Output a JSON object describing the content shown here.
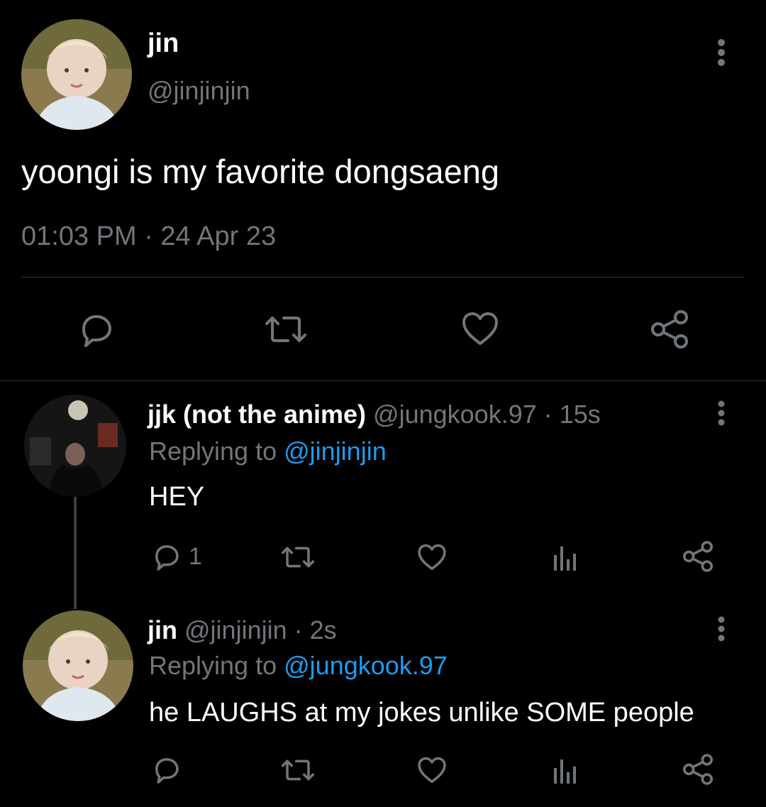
{
  "main_tweet": {
    "display_name": "jin",
    "handle": "@jinjinjin",
    "text": "yoongi is my favorite dongsaeng",
    "timestamp": "01:03 PM · 24 Apr 23",
    "actions": [
      "reply-icon",
      "retweet-icon",
      "like-icon",
      "share-icon"
    ]
  },
  "replies": [
    {
      "display_name": "jjk (not the anime)",
      "handle": "@jungkook.97",
      "age": "· 15s",
      "replying_label": "Replying to",
      "replying_to": "@jinjinjin",
      "text": "HEY",
      "reply_count": "1"
    },
    {
      "display_name": "jin",
      "handle": "@jinjinjin",
      "age": "· 2s",
      "replying_label": "Replying to",
      "replying_to": "@jungkook.97",
      "text": "he LAUGHS at my jokes unlike SOME people",
      "reply_count": ""
    }
  ],
  "colors": {
    "background": "#000000",
    "text": "#e7e9ea",
    "secondary": "#71767b",
    "link": "#1d9bf0",
    "divider": "#2f3336"
  }
}
